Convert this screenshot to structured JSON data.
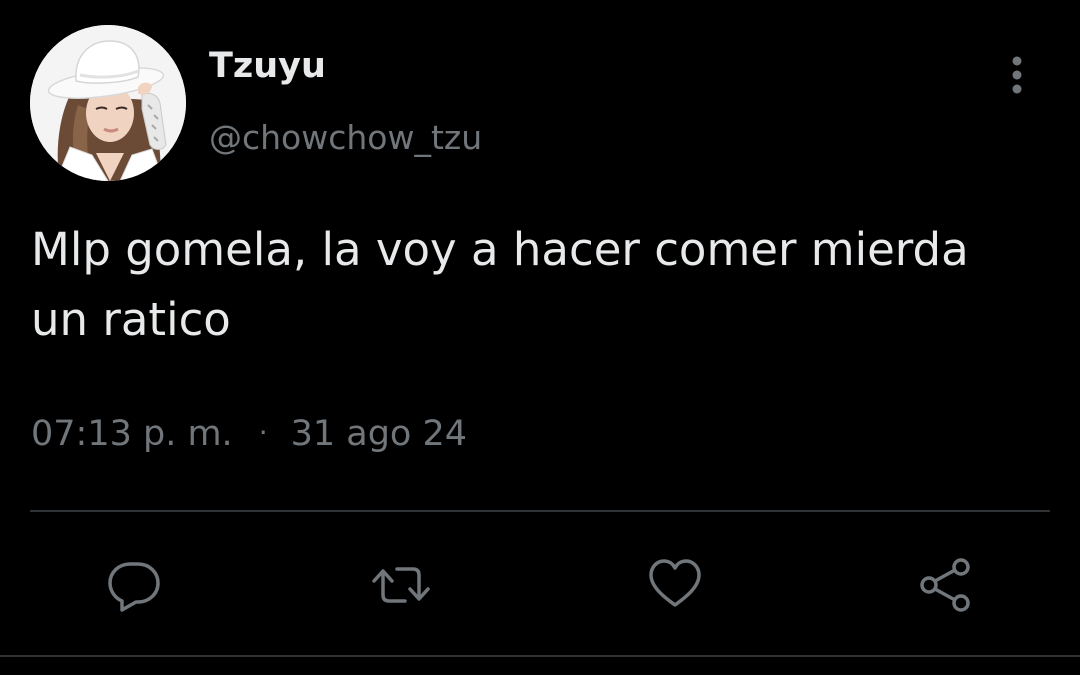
{
  "user": {
    "display_name": "Tzuyu",
    "handle": "@chowchow_tzu"
  },
  "tweet": {
    "text_lines": [
      "Mlp gomela, la voy a hacer comer mierda",
      "un ratico"
    ],
    "time": "07:13 p. m.",
    "separator": "·",
    "date": "31 ago 24"
  },
  "icons": {
    "avatar": "profile-photo",
    "more": "more-vertical-icon",
    "reply": "reply-icon",
    "retweet": "retweet-icon",
    "like": "heart-icon",
    "share": "share-icon"
  },
  "colors": {
    "background": "#000000",
    "primary_text": "#e7e9ea",
    "secondary_text": "#71767b",
    "divider": "#2f3336"
  }
}
